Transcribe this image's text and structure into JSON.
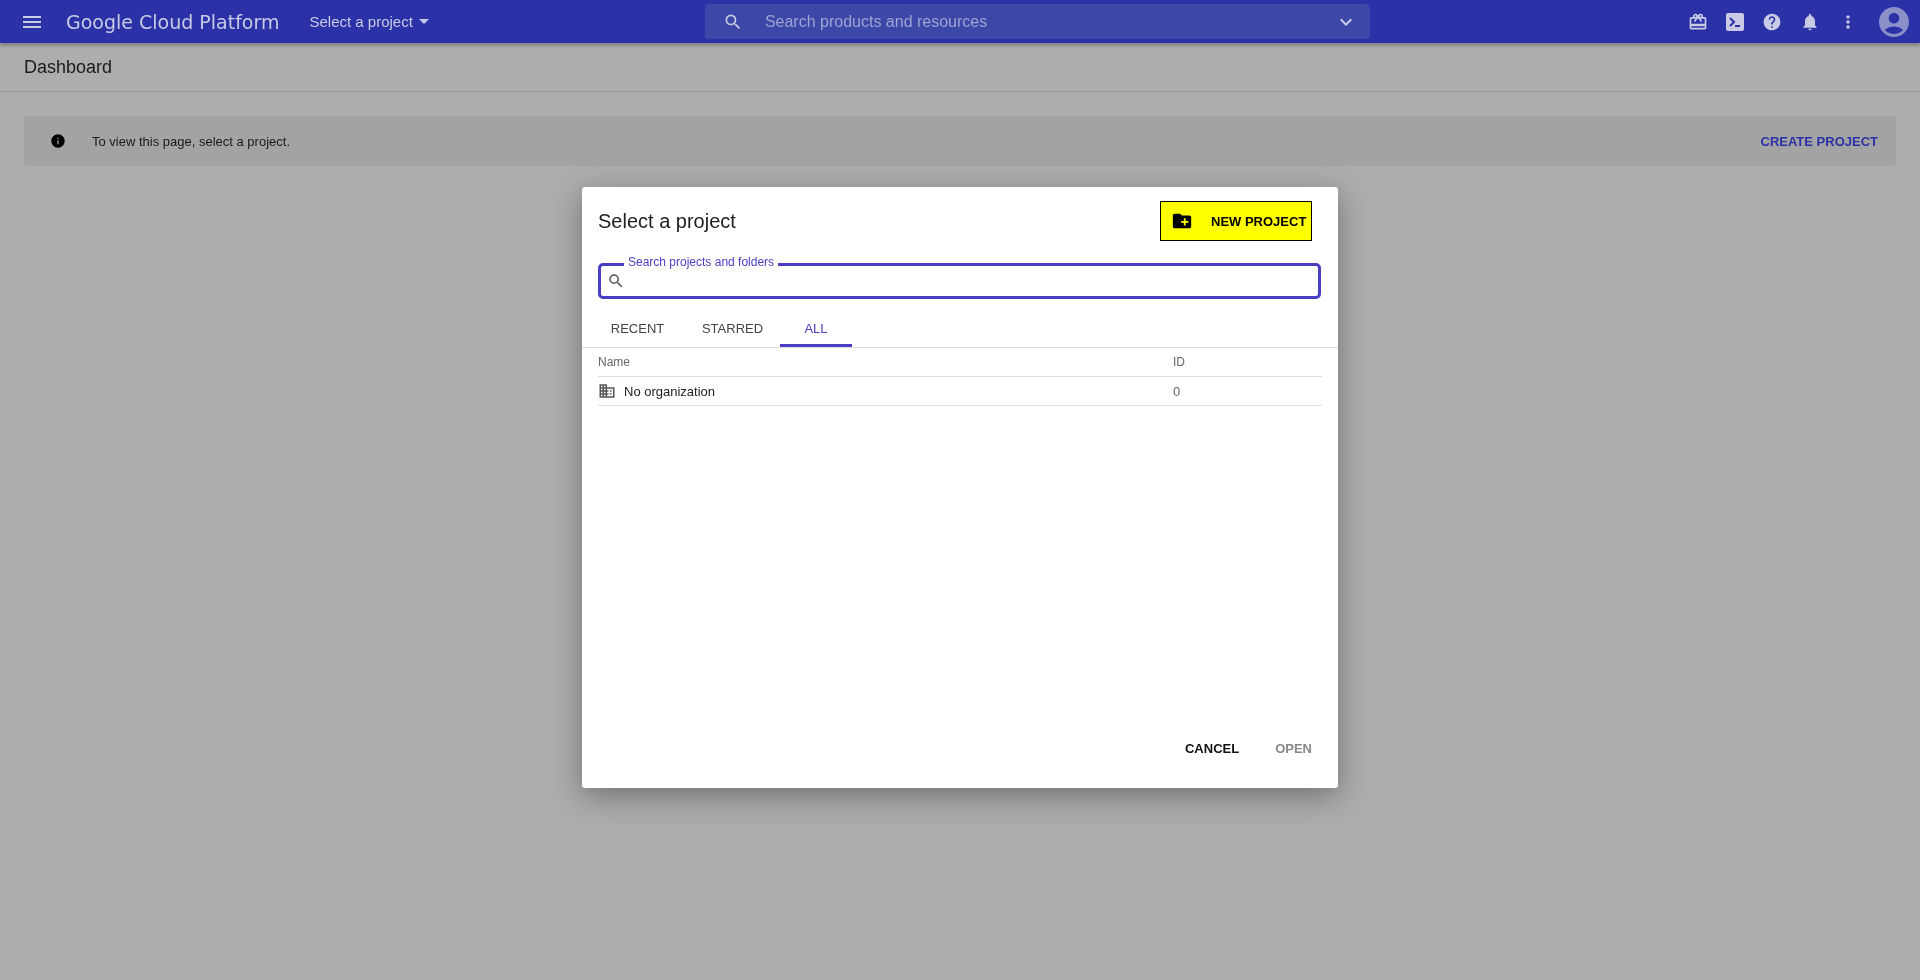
{
  "topbar": {
    "brand": "Google Cloud Platform",
    "project_picker": "Select a project",
    "search": {
      "placeholder": "Search products and resources"
    }
  },
  "page": {
    "title": "Dashboard",
    "banner": {
      "message": "To view this page, select a project.",
      "action": "CREATE PROJECT"
    }
  },
  "dialog": {
    "title": "Select a project",
    "new_project_button": "NEW PROJECT",
    "search": {
      "label": "Search projects and folders"
    },
    "tabs": [
      {
        "label": "RECENT",
        "selected": false
      },
      {
        "label": "STARRED",
        "selected": false
      },
      {
        "label": "ALL",
        "selected": true
      }
    ],
    "table": {
      "columns": [
        "Name",
        "ID"
      ],
      "rows": [
        {
          "name": "No organization",
          "id": "0"
        }
      ]
    },
    "buttons": [
      {
        "label": "CANCEL",
        "disabled": false
      },
      {
        "label": "OPEN",
        "disabled": true
      }
    ]
  }
}
